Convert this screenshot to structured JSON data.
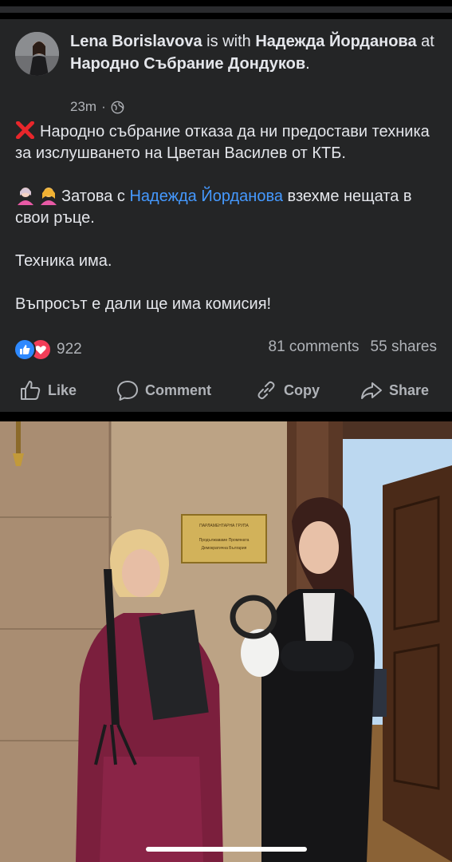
{
  "post": {
    "author": "Lena Borislavova",
    "with_text": " is with ",
    "tagged": "Надежда Йорданова",
    "at_text": " at ",
    "location": "Народно Събрание Дондуков",
    "end_text": ".",
    "time": "23m",
    "dot": "·",
    "privacy_icon": "globe-icon",
    "paragraph1": "Народно събрание отказа да ни предостави техника за изслушването на Цветан Василев от КТБ.",
    "paragraph2_prefix": "Затова с ",
    "paragraph2_mention": "Надежда Йорданова",
    "paragraph2_suffix": " взехме нещата в свои ръце.",
    "paragraph3": "Техника има.",
    "paragraph4": "Въпросът е дали ще има комисия!"
  },
  "engagement": {
    "reaction_count": "922",
    "comments": "81 comments",
    "shares": "55 shares"
  },
  "actions": {
    "like": "Like",
    "comment": "Comment",
    "copy": "Copy",
    "share": "Share"
  },
  "photo": {
    "plaque_line1": "ПАРЛАМЕНТАРНА ГРУПА",
    "plaque_line2": "Продължаваме Промяната",
    "plaque_line3": "Демократична България"
  },
  "colors": {
    "card": "#242526",
    "text": "#e4e6eb",
    "muted": "#b0b3b8",
    "mention": "#4599ff",
    "like_blue": "#2e89ff",
    "love_red": "#f33e58"
  }
}
